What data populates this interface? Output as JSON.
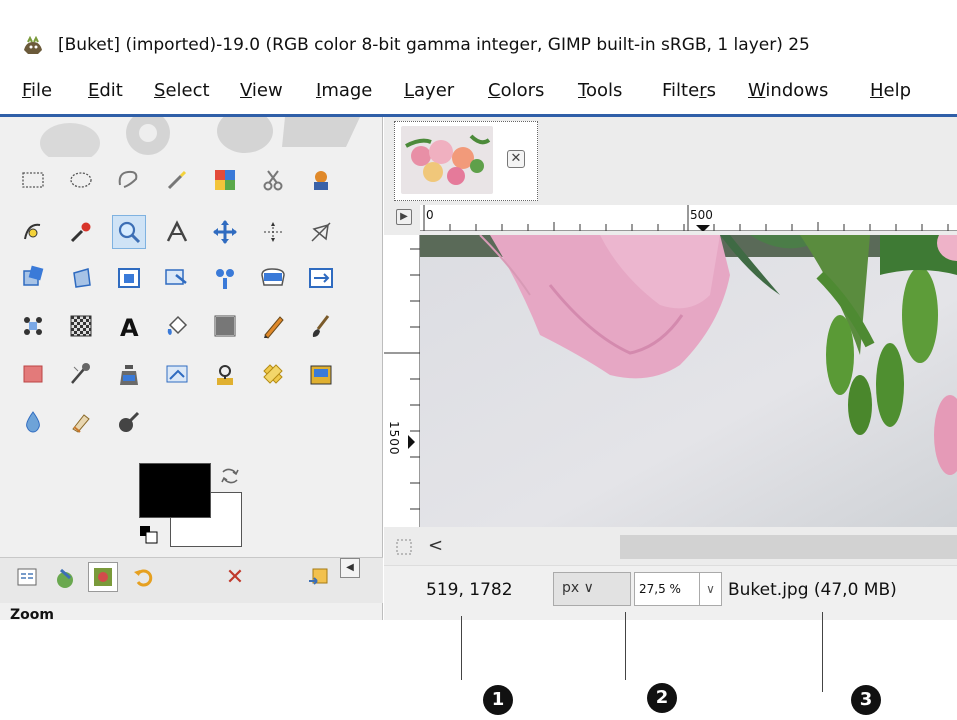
{
  "window": {
    "title": "[Buket] (imported)-19.0 (RGB color 8-bit gamma integer, GIMP built-in sRGB, 1 layer) 25"
  },
  "menu": [
    {
      "pre": "",
      "u": "F",
      "post": "ile"
    },
    {
      "pre": "",
      "u": "E",
      "post": "dit"
    },
    {
      "pre": "",
      "u": "S",
      "post": "elect"
    },
    {
      "pre": "",
      "u": "V",
      "post": "iew"
    },
    {
      "pre": "",
      "u": "I",
      "post": "mage"
    },
    {
      "pre": "",
      "u": "L",
      "post": "ayer"
    },
    {
      "pre": "",
      "u": "C",
      "post": "olors"
    },
    {
      "pre": "",
      "u": "T",
      "post": "ools"
    },
    {
      "pre": "Filte",
      "u": "r",
      "post": "s"
    },
    {
      "pre": "",
      "u": "W",
      "post": "indows"
    },
    {
      "pre": "",
      "u": "H",
      "post": "elp"
    }
  ],
  "toolbox": {
    "tools": [
      "rect-select-icon",
      "ellipse-select-icon",
      "free-select-icon",
      "fuzzy-select-icon",
      "color-select-icon",
      "scissors-select-icon",
      "foreground-select-icon",
      "paths-icon",
      "color-picker-icon",
      "zoom-icon",
      "measure-icon",
      "move-icon",
      "align-icon",
      "transform-icon",
      "rotate-icon",
      "scale-icon",
      "shear-icon",
      "perspective-icon",
      "flip-icon",
      "cage-icon",
      "warp-icon",
      "handle-transform-icon",
      "unified-transform-icon",
      "text-icon",
      "bucket-fill-icon",
      "gradient-icon",
      "pencil-icon",
      "paintbrush-icon",
      "eraser-icon",
      "airbrush-icon",
      "ink-icon",
      "mypaint-brush-icon",
      "clone-icon",
      "heal-icon",
      "perspective-clone-icon",
      "blur-icon",
      "smudge-icon",
      "dodge-burn-icon"
    ],
    "active_tool": "zoom-icon",
    "fg_color": "#000000",
    "bg_color": "#ffffff",
    "zoom_label": "Zoom"
  },
  "image": {
    "ruler_h_labels": [
      "0",
      "500"
    ],
    "ruler_v_label": "1500"
  },
  "status": {
    "coords": "519, 1782",
    "unit": "px",
    "zoom": "27,5 %",
    "file_info": "Buket.jpg (47,0 MB)"
  },
  "callouts": [
    "1",
    "2",
    "3"
  ]
}
